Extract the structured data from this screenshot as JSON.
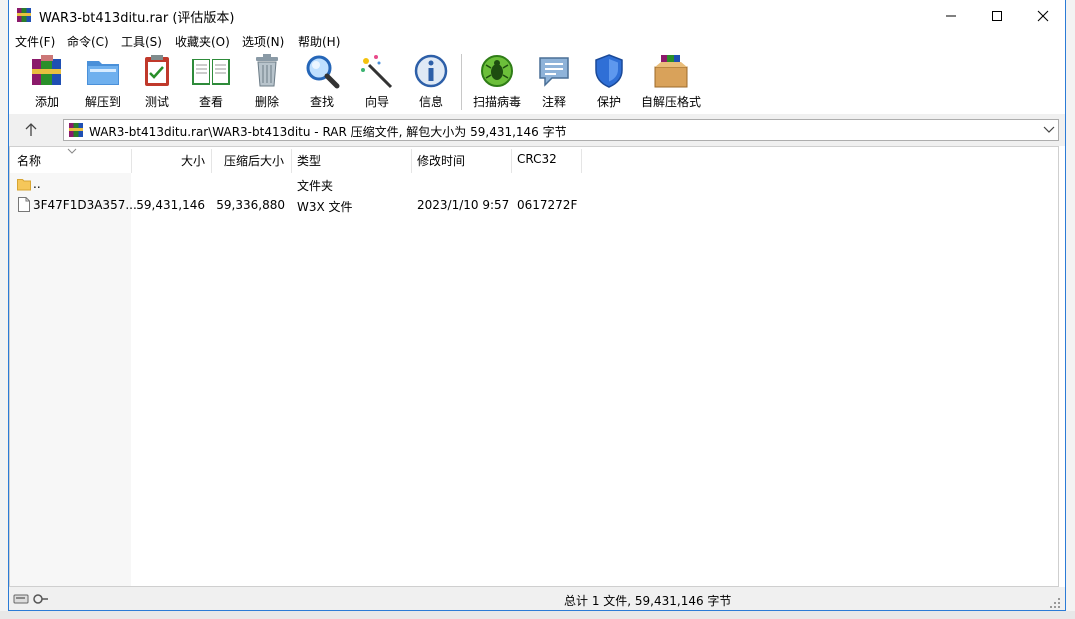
{
  "window": {
    "title": "WAR3-bt413ditu.rar (评估版本)",
    "controls": [
      "minimize",
      "maximize",
      "close"
    ]
  },
  "menu": [
    "文件(F)",
    "命令(C)",
    "工具(S)",
    "收藏夹(O)",
    "选项(N)",
    "帮助(H)"
  ],
  "toolbar": [
    {
      "label": "添加",
      "icon": "add-archive-icon"
    },
    {
      "label": "解压到",
      "icon": "extract-to-icon"
    },
    {
      "label": "测试",
      "icon": "test-icon"
    },
    {
      "label": "查看",
      "icon": "view-book-icon"
    },
    {
      "label": "删除",
      "icon": "trash-icon"
    },
    {
      "label": "查找",
      "icon": "magnifier-icon"
    },
    {
      "label": "向导",
      "icon": "wizard-wand-icon"
    },
    {
      "label": "信息",
      "icon": "info-icon"
    },
    {
      "label": "扫描病毒",
      "icon": "virus-scan-icon"
    },
    {
      "label": "注释",
      "icon": "comment-icon"
    },
    {
      "label": "保护",
      "icon": "shield-icon"
    },
    {
      "label": "自解压格式",
      "icon": "sfx-box-icon"
    }
  ],
  "address": {
    "path": "WAR3-bt413ditu.rar\\WAR3-bt413ditu - RAR 压缩文件, 解包大小为 59,431,146 字节"
  },
  "columns": [
    "名称",
    "大小",
    "压缩后大小",
    "类型",
    "修改时间",
    "CRC32"
  ],
  "rows": [
    {
      "name": "..",
      "size": "",
      "packed": "",
      "type": "文件夹",
      "modified": "",
      "crc": "",
      "icon": "folder-icon"
    },
    {
      "name": "3F47F1D3A357...",
      "size": "59,431,146",
      "packed": "59,336,880",
      "type": "W3X 文件",
      "modified": "2023/1/10 9:57",
      "crc": "0617272F",
      "icon": "file-icon"
    }
  ],
  "status": {
    "summary": "总计 1 文件, 59,431,146 字节"
  },
  "colors": {
    "accent_border": "#2b7bd6",
    "chrome_bg": "#f0f0f0"
  }
}
